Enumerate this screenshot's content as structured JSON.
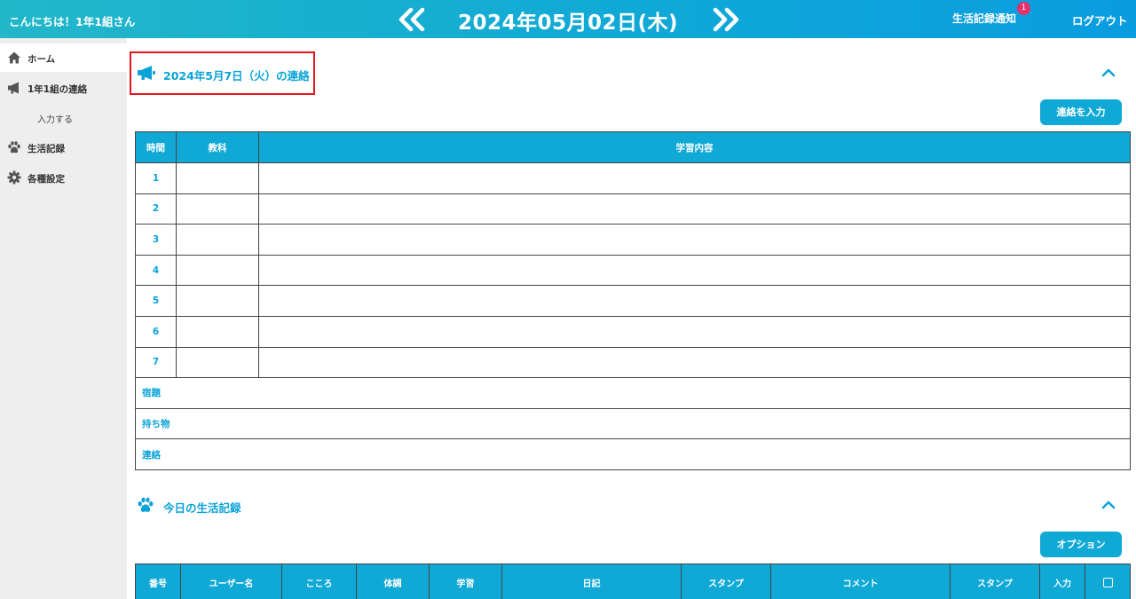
{
  "header": {
    "greeting": "こんにちは！1年1組さん",
    "date": "2024年05月02日(木)",
    "notification_label": "生活記録通知",
    "notification_count": "1",
    "logout_label": "ログアウト"
  },
  "sidebar": {
    "items": [
      {
        "label": "ホーム",
        "icon": "home-icon"
      },
      {
        "label": "1年1組の連絡",
        "icon": "megaphone-icon"
      },
      {
        "label": "入力する"
      },
      {
        "label": "生活記録",
        "icon": "paw-icon"
      },
      {
        "label": "各種設定",
        "icon": "gear-icon"
      }
    ]
  },
  "contact": {
    "title": "2024年5月7日（火）の連絡",
    "input_button": "連絡を入力",
    "headers": [
      "時間",
      "教科",
      "学習内容"
    ],
    "periods": [
      "1",
      "2",
      "3",
      "4",
      "5",
      "6",
      "7"
    ],
    "extra_rows": [
      "宿題",
      "持ち物",
      "連絡"
    ]
  },
  "life_record": {
    "title": "今日の生活記録",
    "option_button": "オプション",
    "headers": [
      "番号",
      "ユーザー名",
      "こころ",
      "体調",
      "学習",
      "日記",
      "スタンプ",
      "コメント",
      "スタンプ",
      "入力"
    ]
  },
  "colors": {
    "accent": "#10a9d6",
    "badge": "#e8316b",
    "highlight": "#e2161d"
  }
}
